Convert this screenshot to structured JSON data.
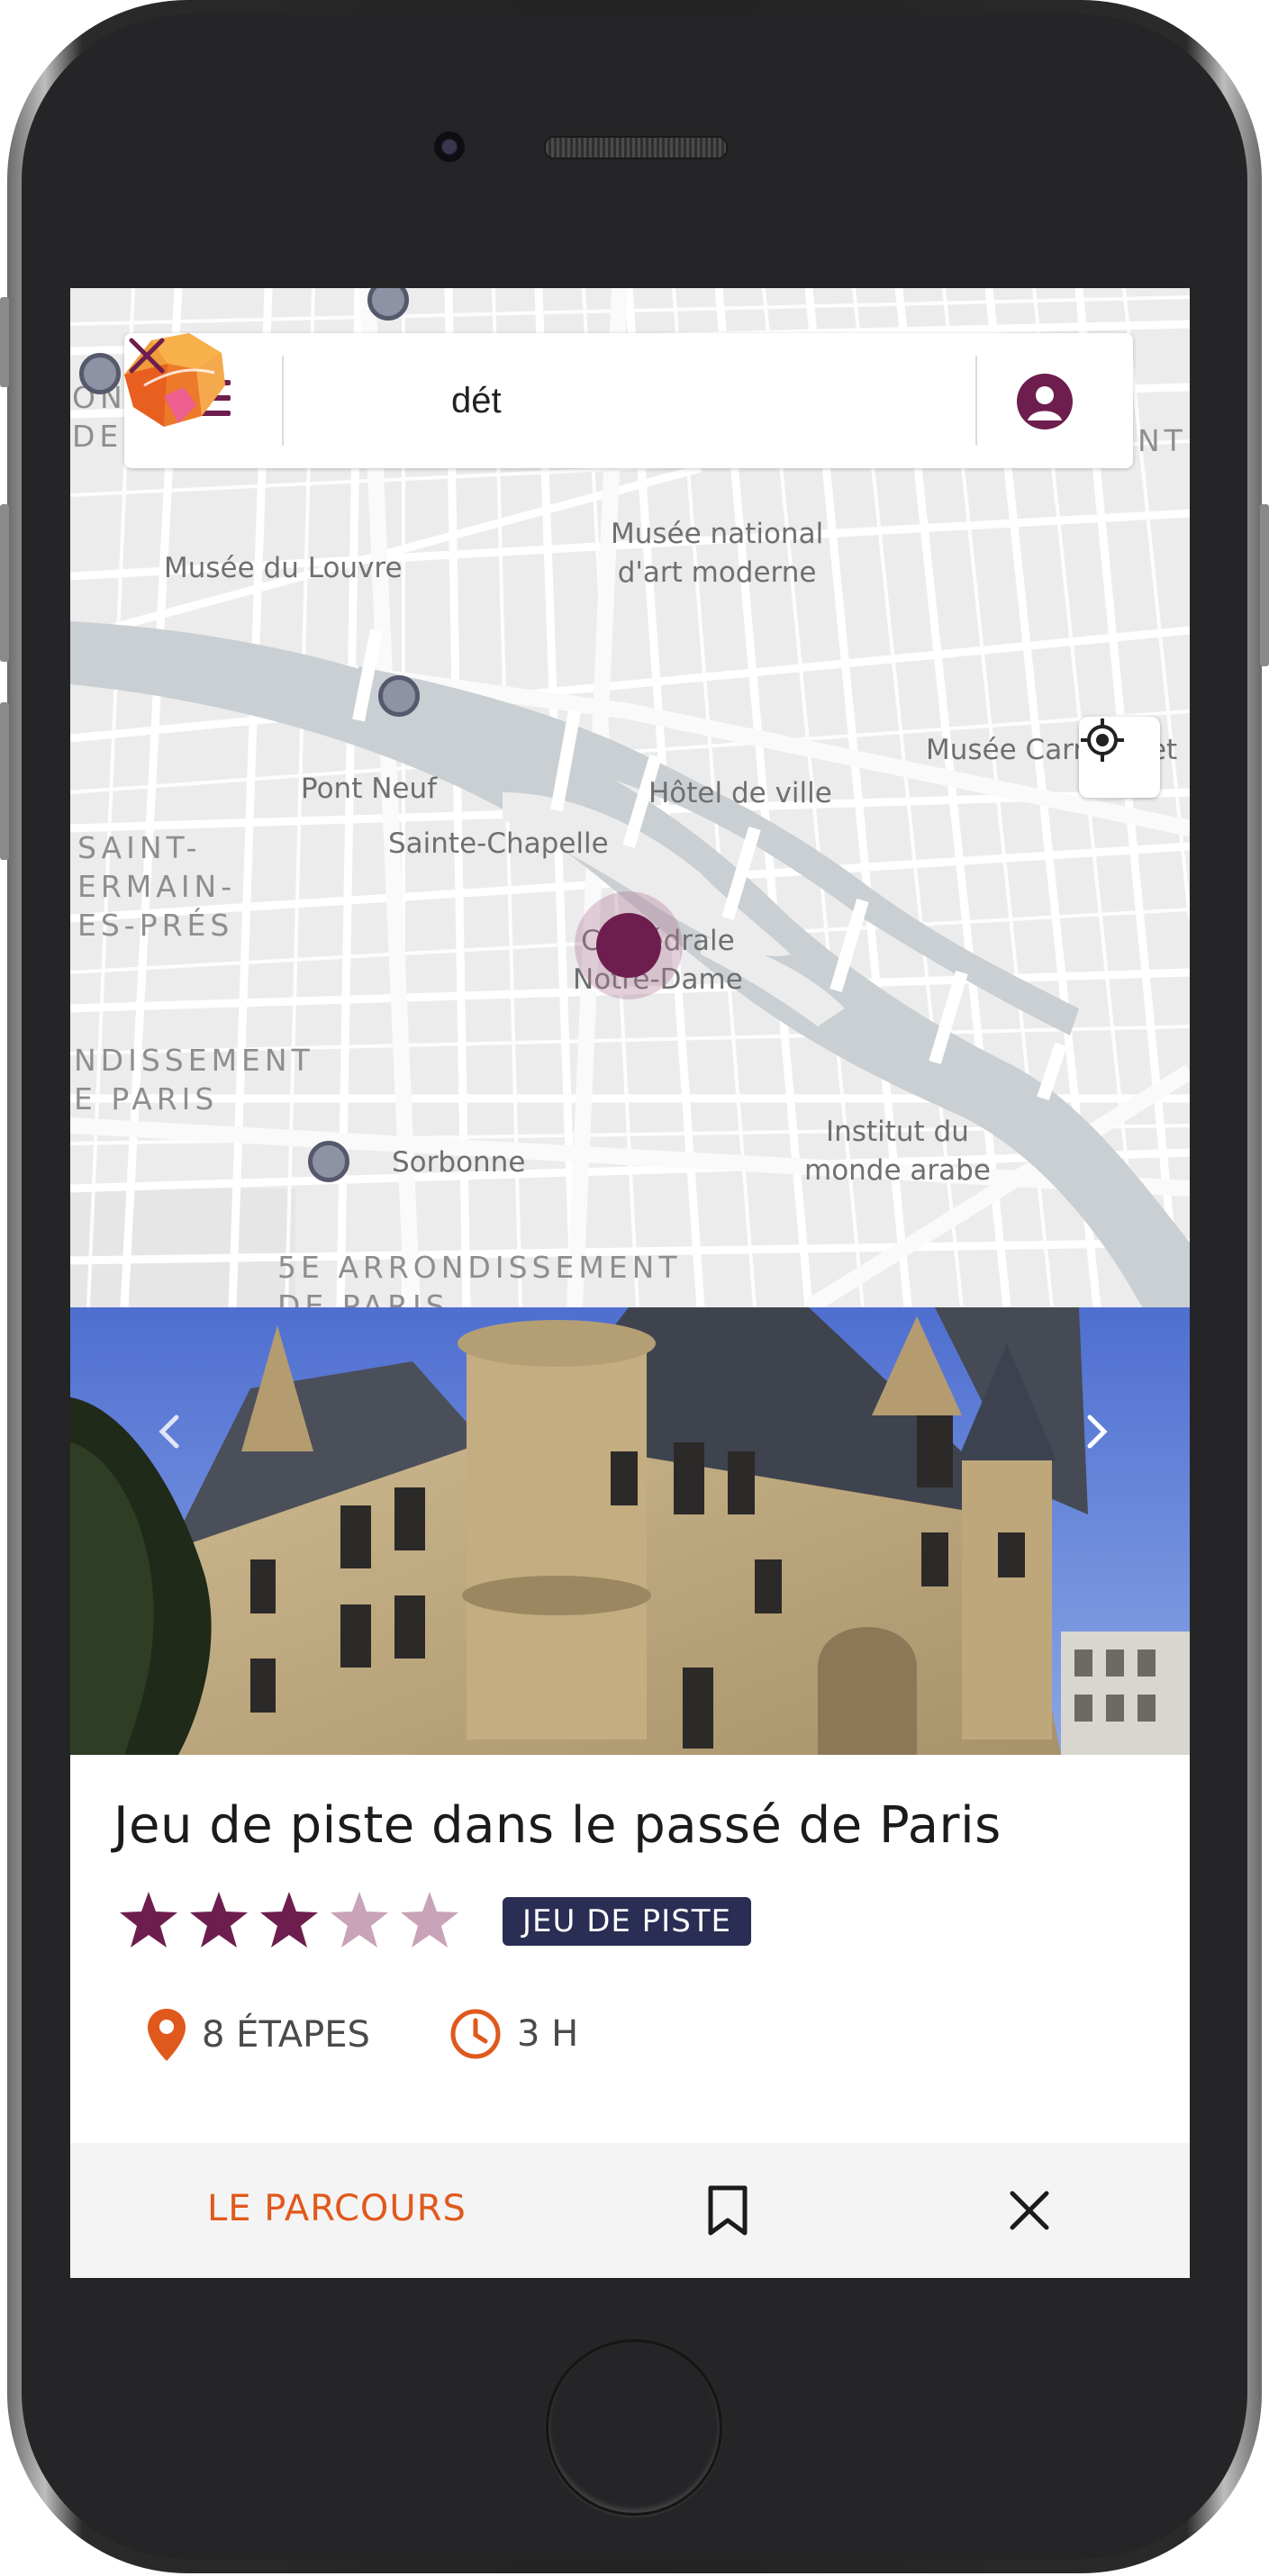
{
  "search": {
    "query": "dét",
    "placeholder": ""
  },
  "map": {
    "labels": {
      "louvre": "Musée du Louvre",
      "moderne_1": "Musée national",
      "moderne_2": "d'art moderne",
      "carnavalet": "Musée Carnavalet",
      "pont_neuf": "Pont Neuf",
      "hotel_de_ville": "Hôtel de ville",
      "sainte_chapelle": "Sainte-Chapelle",
      "st_germain_1": "SAINT-",
      "st_germain_2": "ERMAIN-",
      "st_germain_3": "ES-PRÉS",
      "cathedrale_1": "Cathédrale",
      "cathedrale_2": "Notre-Dame",
      "arr6_1": "NDISSEMENT",
      "arr6_2": "E PARIS",
      "institut_1": "Institut du",
      "institut_2": "monde arabe",
      "sorbonne": "Sorbonne",
      "arr5_1": "5E ARRONDISSEMENT",
      "arr5_2": "DE PARIS",
      "edge_top_left_1": "ON",
      "edge_top_left_2": "DE",
      "edge_top_right": "NT"
    }
  },
  "tour": {
    "title": "Jeu de piste dans le passé de Paris",
    "rating": 3,
    "rating_max": 5,
    "category": "JEU DE PISTE",
    "steps": "8 ÉTAPES",
    "duration": "3 H"
  },
  "actions": {
    "parcours": "LE PARCOURS"
  },
  "colors": {
    "primary": "#6e1e4e",
    "accent": "#e0591c",
    "badge_bg": "#2a2d54",
    "star_empty": "#c9a3b8"
  },
  "icons": {
    "menu": "menu-icon",
    "clear": "close-icon",
    "account": "account-icon",
    "locate": "locate-icon",
    "location": "location-pin-icon",
    "clock": "clock-icon",
    "bookmark": "bookmark-icon",
    "close": "close-icon"
  }
}
